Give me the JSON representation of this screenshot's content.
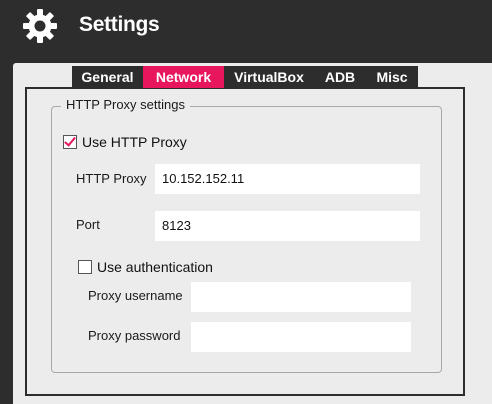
{
  "window": {
    "title": "Settings"
  },
  "tabs": [
    {
      "label": "General",
      "active": false
    },
    {
      "label": "Network",
      "active": true
    },
    {
      "label": "VirtualBox",
      "active": false
    },
    {
      "label": "ADB",
      "active": false
    },
    {
      "label": "Misc",
      "active": false
    }
  ],
  "proxy_group": {
    "legend": "HTTP Proxy settings",
    "use_proxy": {
      "label": "Use HTTP Proxy",
      "checked": true
    },
    "http_proxy": {
      "label": "HTTP Proxy",
      "value": "10.152.152.11"
    },
    "port": {
      "label": "Port",
      "value": "8123"
    },
    "use_auth": {
      "label": "Use authentication",
      "checked": false
    },
    "username": {
      "label": "Proxy username",
      "value": ""
    },
    "password": {
      "label": "Proxy password",
      "value": ""
    }
  },
  "colors": {
    "accent": "#e8175d",
    "chrome": "#2d2d2d",
    "panel": "#ececec"
  },
  "icons": {
    "app": "gear-icon"
  }
}
